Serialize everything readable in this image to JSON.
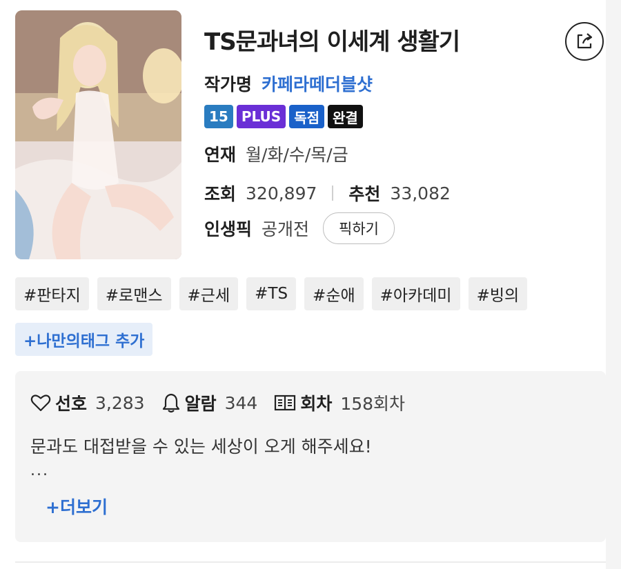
{
  "title": "TS문과녀의 이세계 생활기",
  "author": {
    "label": "작가명",
    "name": "카페라떼더블샷"
  },
  "badges": [
    {
      "text": "15",
      "color": "#2a7cc0"
    },
    {
      "text": "PLUS",
      "color": "#6a2fd6"
    },
    {
      "text": "독점",
      "color": "#1a61c9"
    },
    {
      "text": "완결",
      "color": "#111111"
    }
  ],
  "schedule": {
    "label": "연재",
    "value": "월/화/수/목/금"
  },
  "views": {
    "label": "조회",
    "value": "320,897"
  },
  "recommend": {
    "label": "추천",
    "value": "33,082"
  },
  "popular_pick": {
    "label": "인생픽",
    "value": "공개전",
    "button": "픽하기"
  },
  "tags": [
    "#판타지",
    "#로맨스",
    "#근세",
    "#TS",
    "#순애",
    "#아카데미",
    "#빙의"
  ],
  "add_tag": "+나만의태그 추가",
  "stats": {
    "favorite": {
      "label": "선호",
      "value": "3,283",
      "icon": "heart-icon"
    },
    "alarm": {
      "label": "알람",
      "value": "344",
      "icon": "bell-icon"
    },
    "episodes": {
      "label": "회차",
      "value": "158회차",
      "icon": "book-icon"
    }
  },
  "description": "문과도 대접받을 수 있는 세상이 오게 해주세요!",
  "ellipsis": "...",
  "more": "+더보기",
  "share_icon": "share-icon"
}
